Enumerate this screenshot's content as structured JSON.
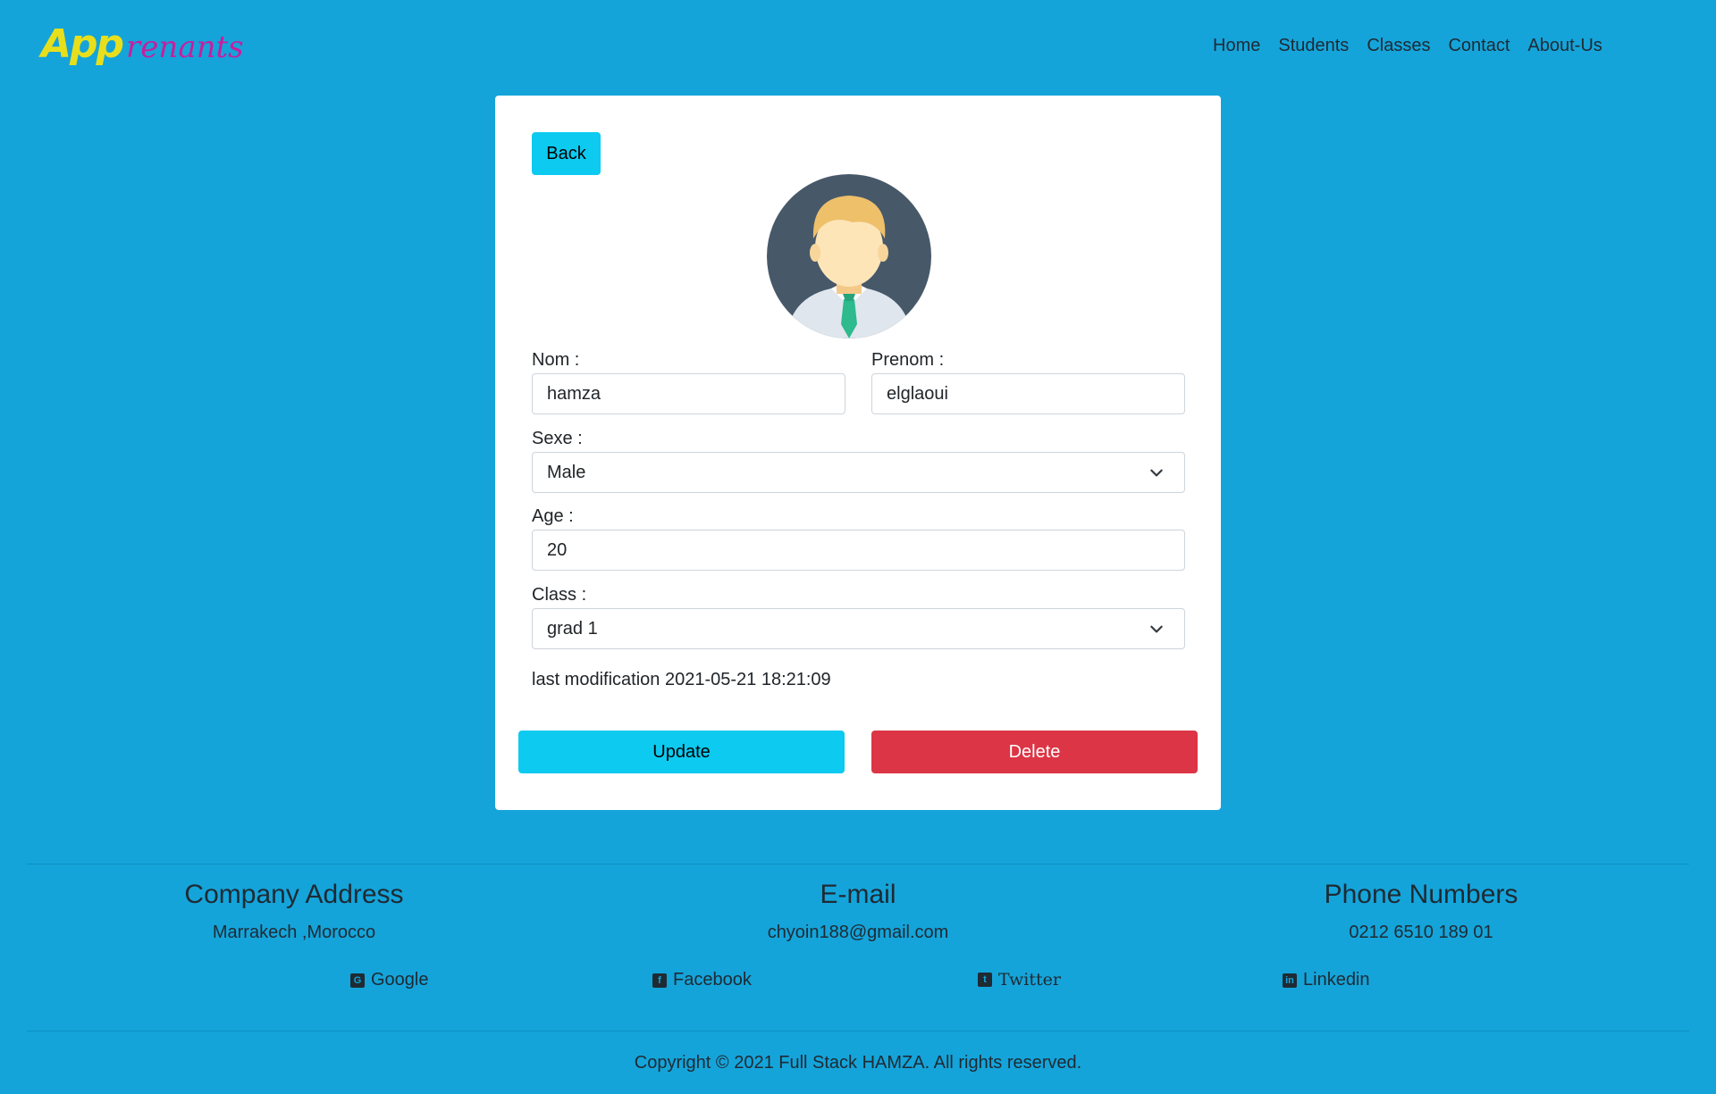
{
  "brand": {
    "part1": "App",
    "part2": "renants",
    "color1": "#e8df1c",
    "color2": "#c81e9e"
  },
  "nav": [
    "Home",
    "Students",
    "Classes",
    "Contact",
    "About-Us"
  ],
  "card": {
    "back_label": "Back",
    "nom_label": "Nom :",
    "nom_value": "hamza",
    "prenom_label": "Prenom :",
    "prenom_value": "elglaoui",
    "sexe_label": "Sexe :",
    "sexe_value": "Male",
    "age_label": "Age :",
    "age_value": "20",
    "class_label": "Class :",
    "class_value": "grad 1",
    "last_modification": "last modification 2021-05-21 18:21:09",
    "update_label": "Update",
    "delete_label": "Delete"
  },
  "footer": {
    "address_title": "Company Address",
    "address_value": "Marrakech ,Morocco",
    "email_title": "E-mail",
    "email_value": "chyoin188@gmail.com",
    "phone_title": "Phone Numbers",
    "phone_value": "0212 6510 189 01",
    "social": {
      "google": "Google",
      "facebook": "Facebook",
      "twitter": "Twitter",
      "linkedin": "Linkedin"
    },
    "copyright": "Copyright © 2021 Full Stack HAMZA. All rights reserved."
  },
  "colors": {
    "background": "#14a4da",
    "info": "#0dcaf0",
    "danger": "#dc3545"
  }
}
